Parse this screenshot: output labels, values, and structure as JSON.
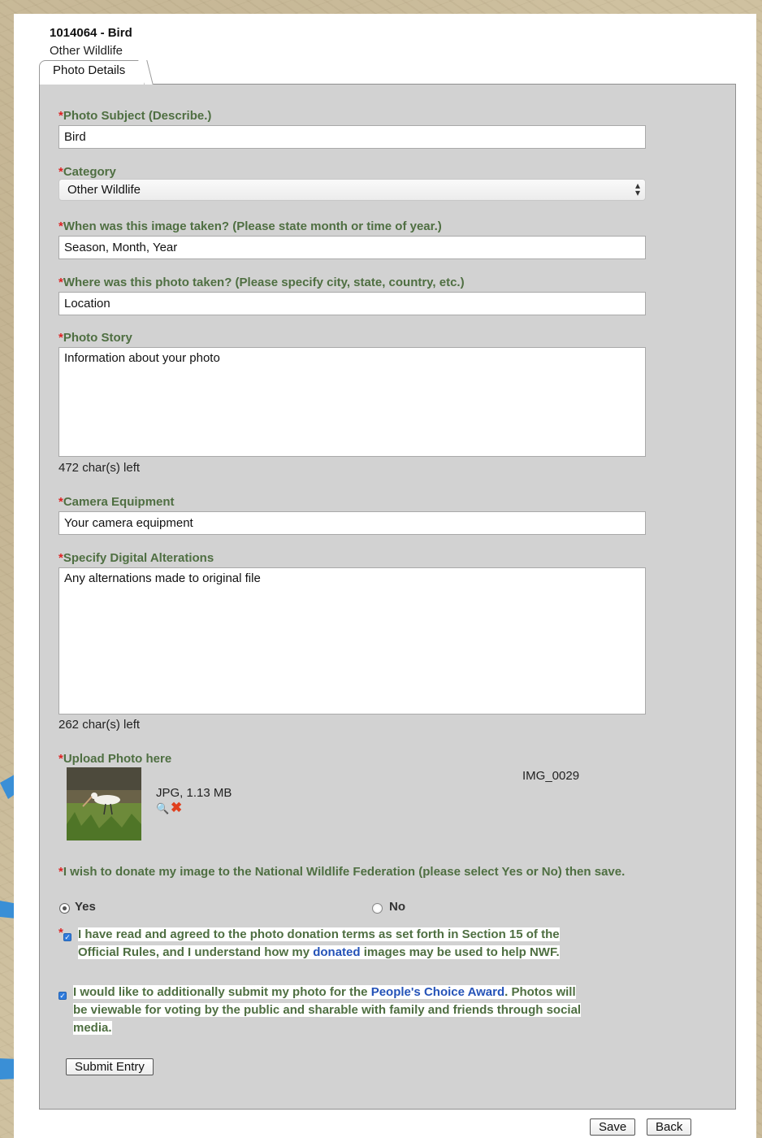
{
  "header": {
    "entry_title": "1014064 - Bird",
    "category_subtitle": "Other Wildlife",
    "tab_label": "Photo Details"
  },
  "required_marker": "*",
  "fields": {
    "subject": {
      "label": "Photo Subject (Describe.)",
      "value": "Bird"
    },
    "category": {
      "label": "Category",
      "selected": "Other Wildlife",
      "arrow": "▴▾"
    },
    "when": {
      "label": "When was this image taken? (Please state month or time of year.)",
      "value": "Season, Month, Year"
    },
    "where": {
      "label": "Where was this photo taken? (Please specify city, state, country, etc.)",
      "value": "Location"
    },
    "story": {
      "label": "Photo Story",
      "value": "Information about your photo",
      "chars_left": "472 char(s) left"
    },
    "camera": {
      "label": "Camera Equipment",
      "value": "Your camera equipment"
    },
    "alterations": {
      "label": "Specify Digital Alterations",
      "value": "Any alternations made to original file",
      "chars_left": "262 char(s) left"
    }
  },
  "upload": {
    "label": "Upload Photo here",
    "file_info": "JPG, 1.13 MB",
    "file_name": "IMG_0029",
    "zoom_icon": "magnifier-icon",
    "delete_icon": "red-x-icon"
  },
  "donation": {
    "question": "I wish to donate my image to the National Wildlife Federation (please select Yes or No) then save.",
    "yes_label": "Yes",
    "no_label": "No",
    "selected": "Yes",
    "terms_part1": "I have read and agreed to the photo donation terms as set forth in Section 15 of the",
    "terms_part2": "Official Rules, and I understand how my",
    "terms_link": "donated",
    "terms_part3": "images may be used to help NWF.",
    "terms_checked": true
  },
  "peoples_choice": {
    "part1": "I would like to additionally submit my photo for the",
    "link": "People's Choice Award",
    "part2": ". Photos will",
    "line2": "be viewable for voting by the public and sharable with family and friends through social",
    "line3": "media.",
    "checked": true
  },
  "buttons": {
    "submit": "Submit Entry",
    "save": "Save",
    "back": "Back"
  },
  "colors": {
    "label_green": "#4f6f42",
    "required_red": "#dd2222",
    "link_blue": "#2553b8",
    "panel_gray": "#d2d2d2",
    "arrow_blue": "#3a8fd6"
  }
}
